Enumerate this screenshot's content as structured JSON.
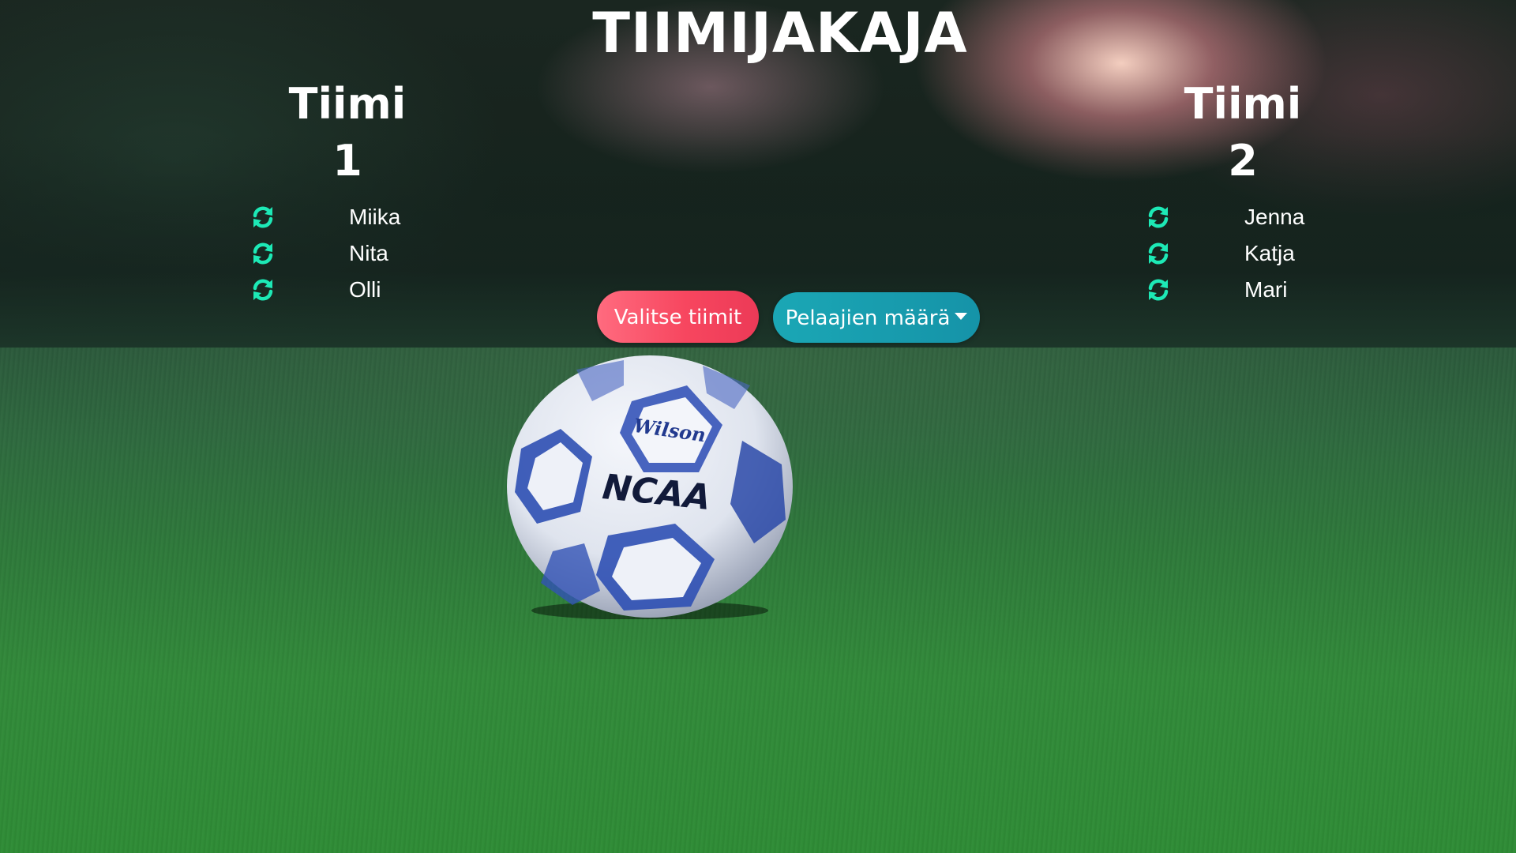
{
  "app": {
    "title": "TIIMIJAKAJA"
  },
  "teams": [
    {
      "title": "Tiimi 1",
      "players": [
        {
          "name": "Miika",
          "icon": "refresh-icon"
        },
        {
          "name": "Nita",
          "icon": "refresh-icon"
        },
        {
          "name": "Olli",
          "icon": "refresh-icon"
        }
      ]
    },
    {
      "title": "Tiimi 2",
      "players": [
        {
          "name": "Jenna",
          "icon": "refresh-icon"
        },
        {
          "name": "Katja",
          "icon": "refresh-icon"
        },
        {
          "name": "Mari",
          "icon": "refresh-icon"
        }
      ]
    }
  ],
  "actions": {
    "select_label": "Valitse tiimit",
    "count_label": "Pelaajien määrä",
    "count_icon": "caret-down-icon"
  },
  "background": {
    "image": "soccer-ball-on-grass",
    "ball_brand": "Wilson",
    "ball_logo": "NCAA"
  },
  "colors": {
    "icon_accent": "#1de9b6",
    "select_button": "#f7465f",
    "count_button": "#1593a8",
    "text": "#ffffff"
  }
}
